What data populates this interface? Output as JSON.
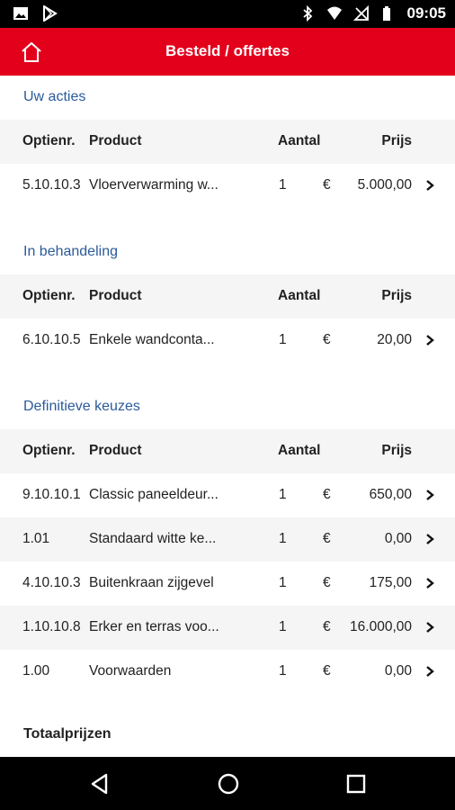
{
  "statusbar": {
    "time": "09:05"
  },
  "appbar": {
    "title": "Besteld / offertes"
  },
  "columns": {
    "optie": "Optienr.",
    "product": "Product",
    "aantal": "Aantal",
    "prijs": "Prijs"
  },
  "currency": "€",
  "sections": {
    "uw_acties": {
      "title": "Uw acties",
      "rows": [
        {
          "optie": "5.10.10.3",
          "product": "Vloerverwarming w...",
          "aantal": "1",
          "prijs": "5.000,00"
        }
      ]
    },
    "in_behandeling": {
      "title": "In behandeling",
      "rows": [
        {
          "optie": "6.10.10.5",
          "product": "Enkele wandconta...",
          "aantal": "1",
          "prijs": "20,00"
        }
      ]
    },
    "definitieve_keuzes": {
      "title": "Definitieve keuzes",
      "rows": [
        {
          "optie": "9.10.10.1",
          "product": "Classic paneeldeur...",
          "aantal": "1",
          "prijs": "650,00"
        },
        {
          "optie": "1.01",
          "product": "Standaard witte ke...",
          "aantal": "1",
          "prijs": "0,00"
        },
        {
          "optie": "4.10.10.3",
          "product": "Buitenkraan zijgevel",
          "aantal": "1",
          "prijs": "175,00"
        },
        {
          "optie": "1.10.10.8",
          "product": "Erker en terras voo...",
          "aantal": "1",
          "prijs": "16.000,00"
        },
        {
          "optie": "1.00",
          "product": "Voorwaarden",
          "aantal": "1",
          "prijs": "0,00"
        }
      ]
    }
  },
  "totaalprijzen": "Totaalprijzen",
  "colors": {
    "brand_red": "#e3001b",
    "section_blue": "#2a5a9a"
  }
}
